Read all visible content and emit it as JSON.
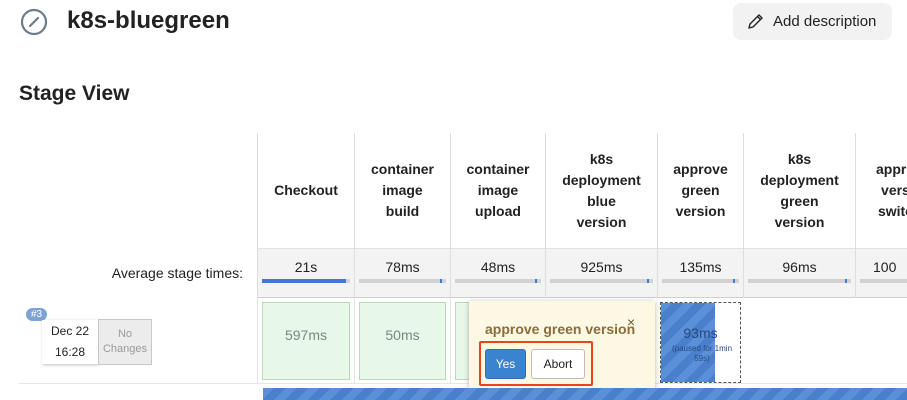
{
  "job": {
    "title": "k8s-bluegreen",
    "add_description_label": "Add description"
  },
  "stage_view": {
    "heading": "Stage View",
    "avg_label": "Average stage times:",
    "stages": [
      {
        "name": "Checkout",
        "avg": "21s",
        "avg_fraction": 0.95
      },
      {
        "name": "container\nimage\nbuild",
        "avg": "78ms",
        "avg_fraction": 0.02
      },
      {
        "name": "container\nimage\nupload",
        "avg": "48ms",
        "avg_fraction": 0.02
      },
      {
        "name": "k8s\ndeployment\nblue\nversion",
        "avg": "925ms",
        "avg_fraction": 0.03
      },
      {
        "name": "approve\ngreen\nversion",
        "avg": "135ms",
        "avg_fraction": 0.02
      },
      {
        "name": "k8s\ndeployment\ngreen\nversion",
        "avg": "96ms",
        "avg_fraction": 0.02
      },
      {
        "name": "appro\nvers\nswitc",
        "avg": "100",
        "avg_fraction": 0.02
      }
    ],
    "run": {
      "build_number": "#3",
      "date": "Dec 22",
      "time": "16:28",
      "changes": "No Changes",
      "cells": [
        "597ms",
        "50ms"
      ],
      "paused_duration": "93ms",
      "paused_note": "(paused for 1min 59s)"
    },
    "input_popup": {
      "title": "approve green version",
      "close_icon": "×",
      "yes_label": "Yes",
      "abort_label": "Abort"
    }
  }
}
